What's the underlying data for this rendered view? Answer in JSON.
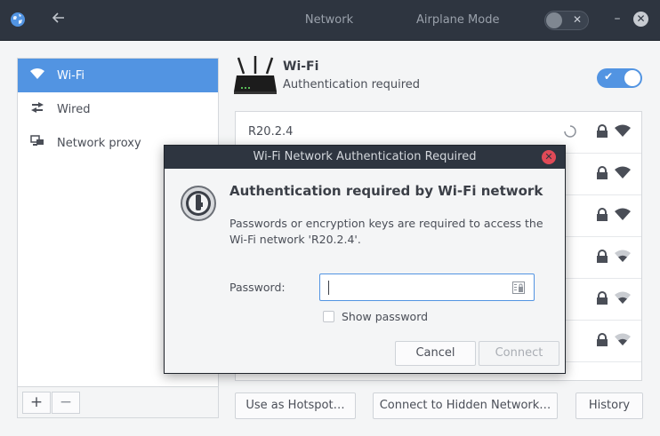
{
  "header": {
    "title": "Network",
    "airplane_label": "Airplane Mode",
    "airplane_on": false,
    "icons": [
      "globe-icon",
      "back-arrow-icon",
      "minimize-icon",
      "close-icon"
    ]
  },
  "sidebar": {
    "items": [
      {
        "label": "Wi-Fi",
        "icon": "wifi-icon",
        "selected": true
      },
      {
        "label": "Wired",
        "icon": "wired-arrows-icon",
        "selected": false
      },
      {
        "label": "Network proxy",
        "icon": "proxy-icon",
        "selected": false
      }
    ],
    "add_label": "+",
    "remove_label": "−"
  },
  "main": {
    "title": "Wi-Fi",
    "status": "Authentication required",
    "wifi_enabled": true,
    "networks": [
      {
        "name": "R20.2.4",
        "connecting": true,
        "secured": true,
        "signal": "strong"
      },
      {
        "name": "",
        "secured": true,
        "signal": "strong"
      },
      {
        "name": "",
        "secured": true,
        "signal": "strong"
      },
      {
        "name": "",
        "secured": true,
        "signal": "weak"
      },
      {
        "name": "",
        "secured": true,
        "signal": "weak"
      },
      {
        "name": "",
        "secured": true,
        "signal": "weak"
      }
    ],
    "buttons": {
      "hotspot": "Use as Hotspot…",
      "hidden": "Connect to Hidden Network…",
      "history": "History"
    }
  },
  "dialog": {
    "title": "Wi-Fi Network Authentication Required",
    "heading": "Authentication required by Wi-Fi network",
    "body": "Passwords or encryption keys are required to access the Wi-Fi network 'R20.2.4'.",
    "password_label": "Password:",
    "password_value": "",
    "show_password_label": "Show password",
    "show_password_checked": false,
    "cancel_label": "Cancel",
    "connect_label": "Connect"
  },
  "colors": {
    "accent": "#5294e2",
    "header_bg": "#2e3540",
    "close_red": "#e14a57"
  }
}
